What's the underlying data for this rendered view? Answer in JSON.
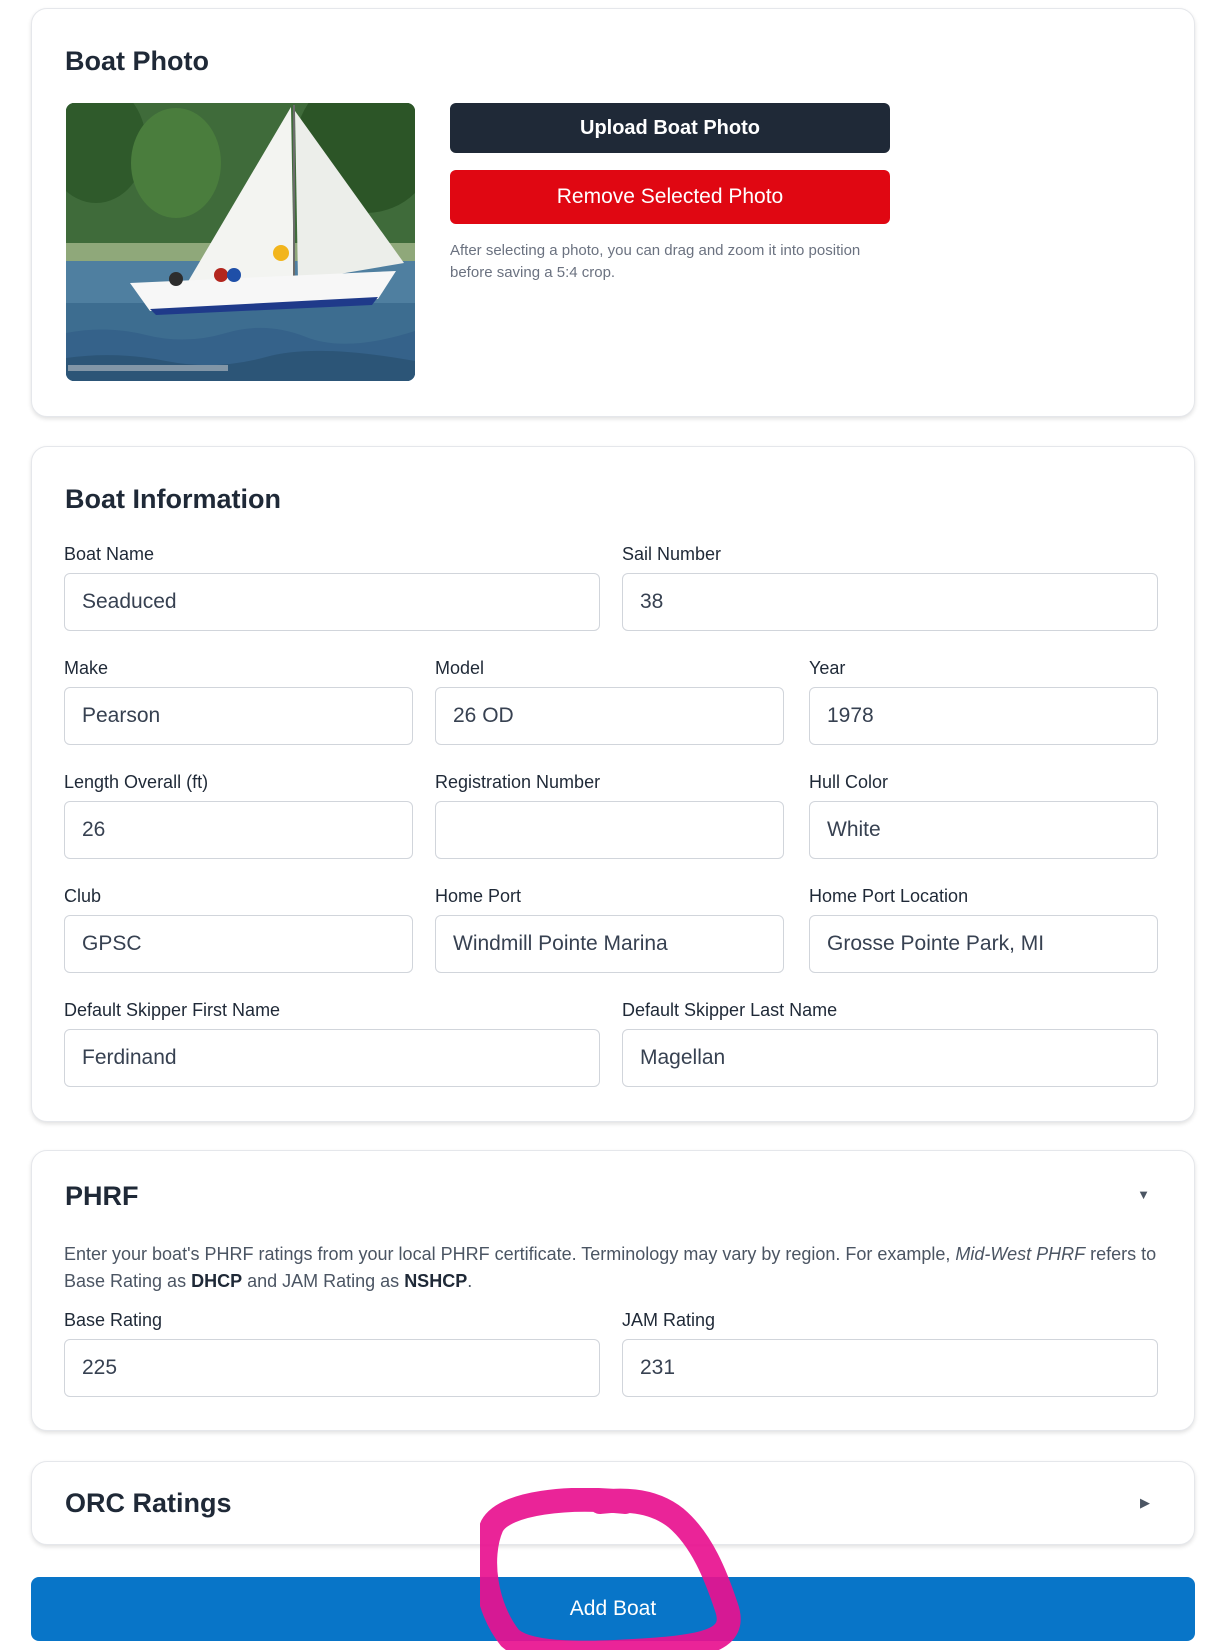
{
  "photo_section": {
    "title": "Boat Photo",
    "upload_label": "Upload Boat Photo",
    "remove_label": "Remove Selected Photo",
    "help_text": "After selecting a photo, you can drag and zoom it into position before saving a 5:4 crop."
  },
  "info_section": {
    "title": "Boat Information",
    "fields": {
      "boat_name": {
        "label": "Boat Name",
        "value": "Seaduced"
      },
      "sail_number": {
        "label": "Sail Number",
        "value": "38"
      },
      "make": {
        "label": "Make",
        "value": "Pearson"
      },
      "model": {
        "label": "Model",
        "value": "26 OD"
      },
      "year": {
        "label": "Year",
        "value": "1978"
      },
      "length_overall": {
        "label": "Length Overall (ft)",
        "value": "26"
      },
      "registration_number": {
        "label": "Registration Number",
        "value": ""
      },
      "hull_color": {
        "label": "Hull Color",
        "value": "White"
      },
      "club": {
        "label": "Club",
        "value": "GPSC"
      },
      "home_port": {
        "label": "Home Port",
        "value": "Windmill Pointe Marina"
      },
      "home_port_location": {
        "label": "Home Port Location",
        "value": "Grosse Pointe Park, MI"
      },
      "skipper_first": {
        "label": "Default Skipper First Name",
        "value": "Ferdinand"
      },
      "skipper_last": {
        "label": "Default Skipper Last Name",
        "value": "Magellan"
      }
    }
  },
  "phrf_section": {
    "title": "PHRF",
    "expanded": true,
    "desc_part1": "Enter your boat's PHRF ratings from your local PHRF certificate. Terminology may vary by region. For example, ",
    "desc_region": "Mid-West PHRF",
    "desc_part2": " refers to Base Rating as ",
    "desc_term1": "DHCP",
    "desc_part3": " and JAM Rating as ",
    "desc_term2": "NSHCP",
    "desc_part4": ".",
    "fields": {
      "base_rating": {
        "label": "Base Rating",
        "value": "225"
      },
      "jam_rating": {
        "label": "JAM Rating",
        "value": "231"
      }
    }
  },
  "orc_section": {
    "title": "ORC Ratings",
    "expanded": false
  },
  "submit": {
    "label": "Add Boat"
  },
  "colors": {
    "dark_button": "#1f2937",
    "danger_button": "#e00712",
    "primary_button": "#0875c8",
    "annotation": "#e8118f"
  },
  "icons": {
    "phrf_toggle": "chevron-down-icon",
    "orc_toggle": "chevron-right-icon"
  }
}
